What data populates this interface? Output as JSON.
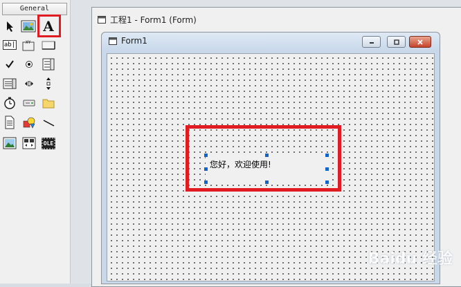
{
  "toolbox": {
    "header": "General",
    "tools": [
      {
        "id": "pointer",
        "icon": "pointer-icon"
      },
      {
        "id": "picturebox",
        "icon": "picturebox-icon"
      },
      {
        "id": "label",
        "icon": "label-icon",
        "glyph": "A",
        "selected": true
      },
      {
        "id": "textbox",
        "icon": "textbox-icon",
        "glyph": "ab|"
      },
      {
        "id": "frame",
        "icon": "frame-icon",
        "glyph": "XY"
      },
      {
        "id": "commandbutton",
        "icon": "commandbutton-icon"
      },
      {
        "id": "checkbox",
        "icon": "checkbox-icon"
      },
      {
        "id": "optionbutton",
        "icon": "optionbutton-icon"
      },
      {
        "id": "combobox",
        "icon": "combobox-icon"
      },
      {
        "id": "listbox",
        "icon": "listbox-icon"
      },
      {
        "id": "hscrollbar",
        "icon": "hscrollbar-icon"
      },
      {
        "id": "vscrollbar",
        "icon": "vscrollbar-icon"
      },
      {
        "id": "timer",
        "icon": "timer-icon"
      },
      {
        "id": "drivelistbox",
        "icon": "drivelistbox-icon"
      },
      {
        "id": "dirlistbox",
        "icon": "dirlistbox-icon"
      },
      {
        "id": "filelistbox",
        "icon": "filelistbox-icon"
      },
      {
        "id": "shape",
        "icon": "shape-icon"
      },
      {
        "id": "line",
        "icon": "line-icon"
      },
      {
        "id": "image",
        "icon": "image-icon"
      },
      {
        "id": "data",
        "icon": "data-icon"
      },
      {
        "id": "ole",
        "icon": "ole-icon",
        "glyph": "OLE"
      }
    ]
  },
  "form_window": {
    "title": "工程1 - Form1 (Form)"
  },
  "designer": {
    "title": "Form1",
    "label_caption": "您好，欢迎使用!"
  },
  "watermark": "Baidu 经验",
  "colors": {
    "highlight": "#e11b22",
    "selection_handle": "#1264c8"
  }
}
